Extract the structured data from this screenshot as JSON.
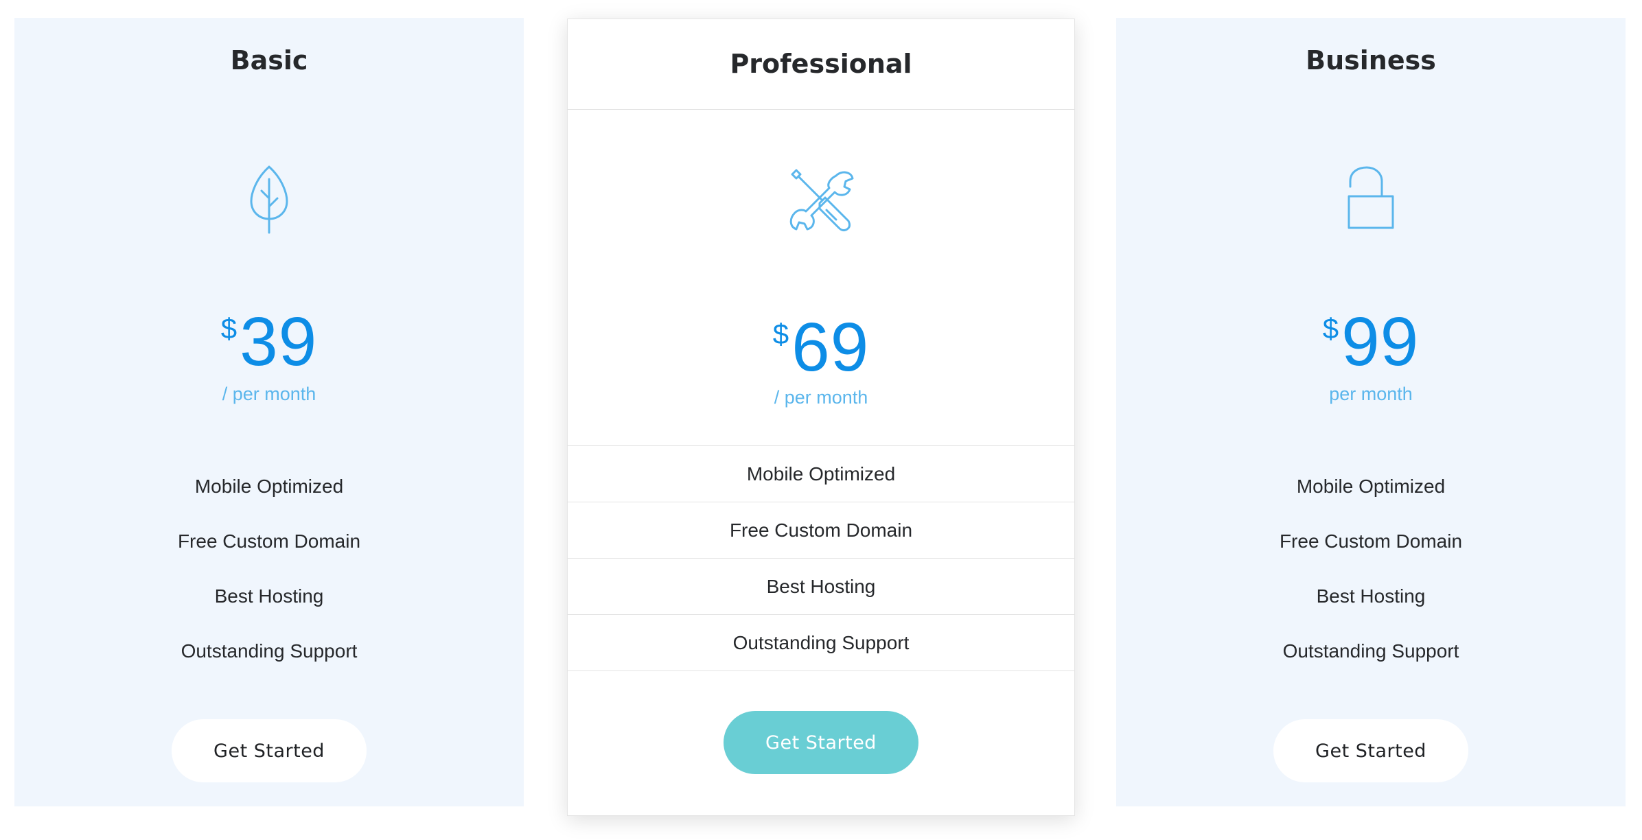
{
  "colors": {
    "side_card_bg": "#f0f6fd",
    "price": "#0d8de6",
    "period": "#5bb6ec",
    "icon": "#5bb6ec",
    "featured_button": "#69ced4"
  },
  "plans": [
    {
      "title": "Basic",
      "icon": "leaf-icon",
      "currency": "$",
      "price": "39",
      "period": "/ per month",
      "features": [
        "Mobile Optimized",
        "Free Custom Domain",
        "Best Hosting",
        "Outstanding Support"
      ],
      "button": "Get Started"
    },
    {
      "title": "Professional",
      "icon": "tools-icon",
      "currency": "$",
      "price": "69",
      "period": "/ per month",
      "features": [
        "Mobile Optimized",
        "Free Custom Domain",
        "Best Hosting",
        "Outstanding Support"
      ],
      "button": "Get Started",
      "featured": true
    },
    {
      "title": "Business",
      "icon": "unlocked-padlock-icon",
      "currency": "$",
      "price": "99",
      "period": "per month",
      "features": [
        "Mobile Optimized",
        "Free Custom Domain",
        "Best Hosting",
        "Outstanding Support"
      ],
      "button": "Get Started"
    }
  ]
}
